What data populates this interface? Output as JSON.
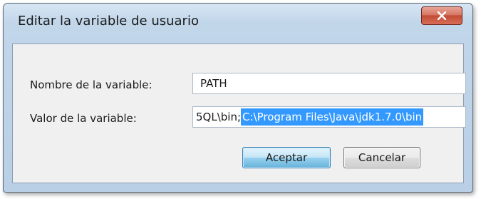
{
  "dialog": {
    "title": "Editar la variable de usuario"
  },
  "fields": {
    "name_label": "Nombre de la variable:",
    "name_value": "PATH",
    "value_label": "Valor de la variable:",
    "value_unselected": "5QL\\bin;",
    "value_selected": "C:\\Program Files\\Java\\jdk1.7.0\\bin"
  },
  "buttons": {
    "accept": "Aceptar",
    "cancel": "Cancelar"
  },
  "icons": {
    "close": "close-icon"
  }
}
